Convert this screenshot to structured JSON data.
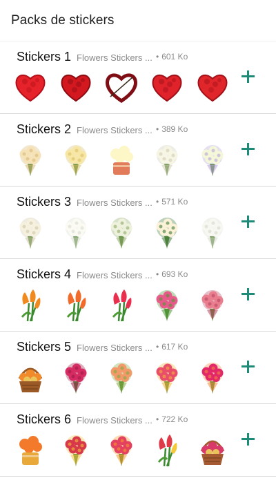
{
  "header": {
    "title": "Packs de stickers"
  },
  "packs": [
    {
      "name": "Stickers 1",
      "author": "Flowers Stickers ...",
      "size": "601 Ko",
      "stickers": [
        {
          "icon": "red-rose-heart-icon",
          "colors": [
            "#e6232b",
            "#b30f18"
          ]
        },
        {
          "icon": "red-roses-heart-icon",
          "colors": [
            "#d41820",
            "#8a0c12"
          ]
        },
        {
          "icon": "rose-heart-outline-icon",
          "colors": [
            "#c8161e",
            "#7e0d14"
          ]
        },
        {
          "icon": "red-roses-heart-icon",
          "colors": [
            "#e0222a",
            "#9d1018"
          ]
        },
        {
          "icon": "red-roses-heart-icon",
          "colors": [
            "#e1262b",
            "#a11118"
          ]
        }
      ]
    },
    {
      "name": "Stickers 2",
      "author": "Flowers Stickers ...",
      "size": "389 Ko",
      "stickers": [
        {
          "icon": "cream-bouquet-icon",
          "colors": [
            "#f6e2b7",
            "#d9b97a"
          ]
        },
        {
          "icon": "yellow-bouquet-icon",
          "colors": [
            "#f7e6a4",
            "#d8c06a"
          ]
        },
        {
          "icon": "flower-box-icon",
          "colors": [
            "#fdf6c6",
            "#e27b5a"
          ]
        },
        {
          "icon": "white-roses-bouquet-icon",
          "colors": [
            "#f7f5e4",
            "#cfcbb4"
          ]
        },
        {
          "icon": "white-bouquet-icon",
          "colors": [
            "#f4f7d8",
            "#b6a2d8"
          ]
        }
      ]
    },
    {
      "name": "Stickers 3",
      "author": "Flowers Stickers ...",
      "size": "571 Ko",
      "stickers": [
        {
          "icon": "white-roses-bouquet-icon",
          "colors": [
            "#f5f1de",
            "#cdc6a8"
          ]
        },
        {
          "icon": "white-roses-bouquet-icon",
          "colors": [
            "#fbfbf4",
            "#d8dcd0"
          ]
        },
        {
          "icon": "white-roses-bouquet-icon",
          "colors": [
            "#eef2dc",
            "#8faa6a"
          ]
        },
        {
          "icon": "cream-roses-bouquet-icon",
          "colors": [
            "#fbf2d8",
            "#3f7a3a"
          ]
        },
        {
          "icon": "white-roses-bouquet-icon",
          "colors": [
            "#f8f8f2",
            "#d6d8cc"
          ]
        }
      ]
    },
    {
      "name": "Stickers 4",
      "author": "Flowers Stickers ...",
      "size": "693 Ko",
      "stickers": [
        {
          "icon": "orange-tulips-icon",
          "colors": [
            "#f08a1e",
            "#3e8a2e"
          ]
        },
        {
          "icon": "orange-tulips-icon",
          "colors": [
            "#f26b2a",
            "#3d8a2f"
          ]
        },
        {
          "icon": "pink-tulips-icon",
          "colors": [
            "#e8304e",
            "#3c8a30"
          ]
        },
        {
          "icon": "mixed-bouquet-icon",
          "colors": [
            "#e85a8a",
            "#4b9a33"
          ]
        },
        {
          "icon": "pink-bouquet-icon",
          "colors": [
            "#e97e8e",
            "#b64660"
          ]
        }
      ]
    },
    {
      "name": "Stickers 5",
      "author": "Flowers Stickers ...",
      "size": "617 Ko",
      "stickers": [
        {
          "icon": "flower-basket-icon",
          "colors": [
            "#f08a2a",
            "#9b5a25"
          ]
        },
        {
          "icon": "pink-roses-bouquet-icon",
          "colors": [
            "#d62b63",
            "#9c1d49"
          ]
        },
        {
          "icon": "mixed-bouquet-icon",
          "colors": [
            "#f29a6a",
            "#7fab3e"
          ]
        },
        {
          "icon": "mixed-bouquet-icon",
          "colors": [
            "#e84e6a",
            "#f2b23a"
          ]
        },
        {
          "icon": "wrapped-bouquet-icon",
          "colors": [
            "#e3286a",
            "#f08a3a"
          ]
        }
      ]
    },
    {
      "name": "Stickers 6",
      "author": "Flowers Stickers ...",
      "size": "722 Ko",
      "stickers": [
        {
          "icon": "orange-pot-bouquet-icon",
          "colors": [
            "#f27a2a",
            "#e8a83a"
          ]
        },
        {
          "icon": "mixed-bouquet-icon",
          "colors": [
            "#d8394a",
            "#f0c23a"
          ]
        },
        {
          "icon": "mixed-bouquet-icon",
          "colors": [
            "#e44060",
            "#f59a2a"
          ]
        },
        {
          "icon": "tulip-bouquet-icon",
          "colors": [
            "#e03a48",
            "#f3c83a"
          ]
        },
        {
          "icon": "flower-basket-icon",
          "colors": [
            "#d83a6a",
            "#a55a32"
          ]
        }
      ]
    }
  ],
  "accent_color": "#1e8a78"
}
